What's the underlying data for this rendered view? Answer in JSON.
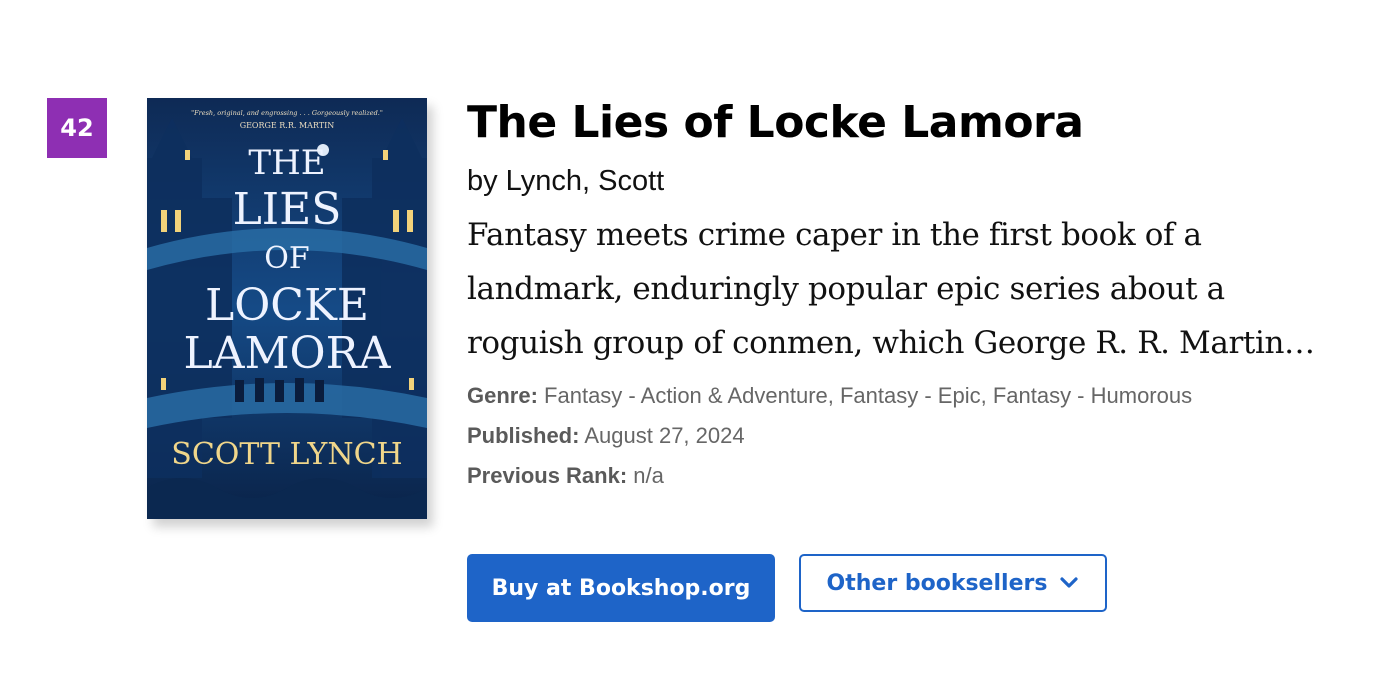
{
  "rank": "42",
  "cover": {
    "blurb": "\"Fresh, original, and engrossing . . . Gorgeously realized.\"",
    "blurb_author": "GEORGE R.R. MARTIN",
    "title_lines": [
      "THE",
      "LIES",
      "OF",
      "LOCKE",
      "LAMORA"
    ],
    "author": "SCOTT LYNCH"
  },
  "book": {
    "title": "The Lies of Locke Lamora",
    "author": "by Lynch, Scott",
    "description": "Fantasy meets crime caper in the first book of a landmark, enduringly popular epic series about a roguish group of conmen, which George R. R. Martin…"
  },
  "meta": {
    "genre_label": "Genre:",
    "genre_value": "Fantasy - Action & Adventure, Fantasy - Epic, Fantasy - Humorous",
    "published_label": "Published:",
    "published_value": "August 27, 2024",
    "previous_rank_label": "Previous Rank:",
    "previous_rank_value": "n/a"
  },
  "buttons": {
    "buy_label": "Buy at Bookshop.org",
    "other_label": "Other booksellers",
    "other_icon": "chevron-down-icon"
  },
  "colors": {
    "rank_badge": "#8e2fb3",
    "primary_button": "#1e64c8"
  }
}
